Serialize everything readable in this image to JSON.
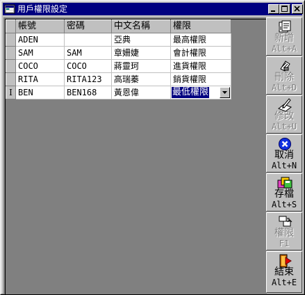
{
  "window": {
    "title": "用戶權限設定"
  },
  "grid": {
    "columns": [
      "帳號",
      "密碼",
      "中文名稱",
      "權限"
    ],
    "rows": [
      {
        "account": "ADEN",
        "password": "",
        "name": "亞典",
        "permission": "最高權限"
      },
      {
        "account": "SAM",
        "password": "SAM",
        "name": "章姍婕",
        "permission": "會計權限"
      },
      {
        "account": "COCO",
        "password": "COCO",
        "name": "蔣靈珂",
        "permission": "進貨權限"
      },
      {
        "account": "RITA",
        "password": "RITA123",
        "name": "高瑞蓁",
        "permission": "銷貨權限"
      },
      {
        "account": "BEN",
        "password": "BEN168",
        "name": "黃恩偉",
        "permission": "最低權限"
      }
    ],
    "current_row_marker": "I"
  },
  "toolbar": {
    "add": {
      "label": "新增",
      "key": "Alt+A",
      "enabled": false,
      "icon": "add-record-icon"
    },
    "delete": {
      "label": "刪除",
      "key": "Alt+D",
      "enabled": false,
      "icon": "delete-record-icon"
    },
    "edit": {
      "label": "修改",
      "key": "Alt+U",
      "enabled": false,
      "icon": "edit-record-icon"
    },
    "cancel": {
      "label": "取消",
      "key": "Alt+N",
      "enabled": true,
      "icon": "cancel-x-icon"
    },
    "save": {
      "label": "存檔",
      "key": "Alt+S",
      "enabled": true,
      "icon": "save-disks-icon"
    },
    "permission": {
      "label": "權限",
      "key": "F1",
      "enabled": false,
      "icon": "permission-icon"
    },
    "exit": {
      "label": "結束",
      "key": "Alt+E",
      "enabled": true,
      "icon": "exit-door-icon"
    }
  },
  "colors": {
    "titlebar": "#000080",
    "face": "#c0c0c0",
    "selection": "#000080",
    "cancel_icon": "#1030e0"
  }
}
